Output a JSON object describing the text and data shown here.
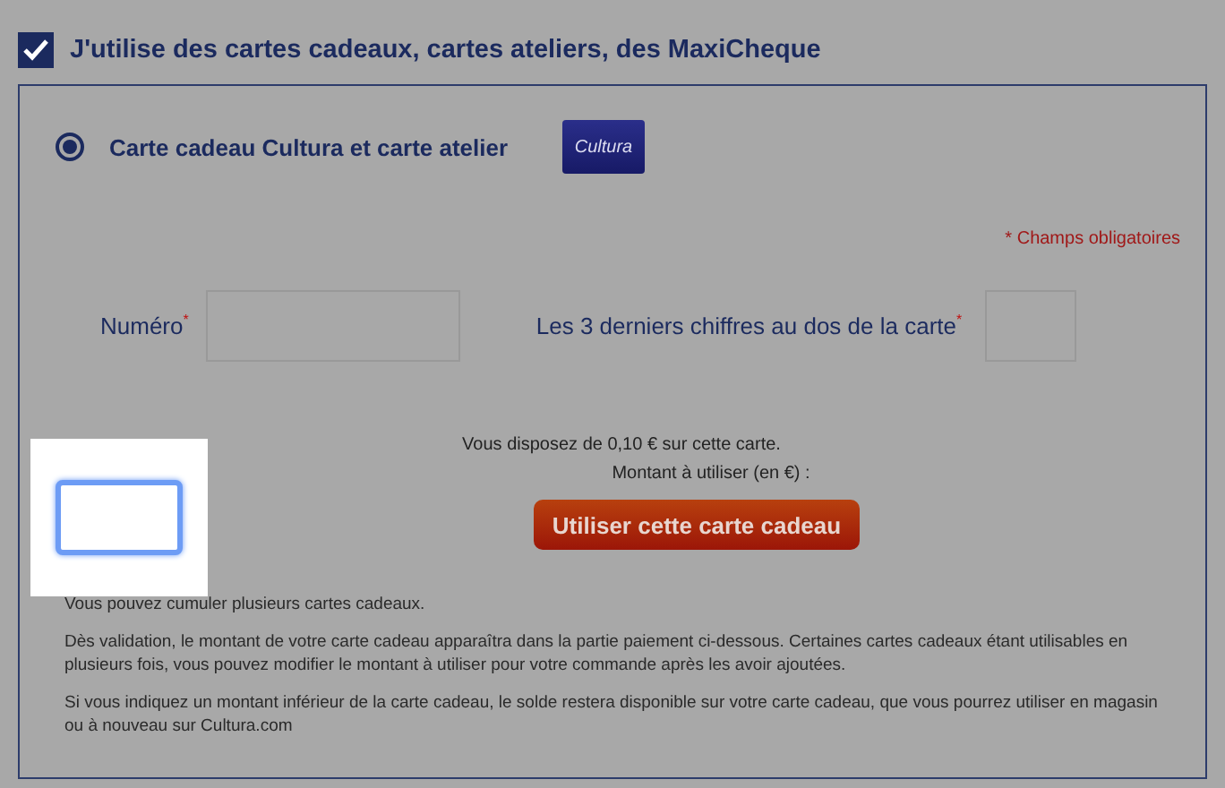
{
  "section": {
    "label": "J'utilise des cartes cadeaux, cartes ateliers, des MaxiCheque",
    "checked": true
  },
  "options": [
    {
      "label": "Carte cadeau Cultura et carte atelier",
      "selected": true,
      "logo": "Cultura"
    }
  ],
  "required_note": "* Champs obligatoires",
  "fields": [
    {
      "label": "Numéro",
      "mark": "*",
      "kind": "wide"
    },
    {
      "label": "Les 3 derniers chiffres au dos de la carte",
      "mark": "*",
      "kind": "narrow"
    }
  ],
  "balance": "Vous disposez de 0,10 € sur cette carte.",
  "amount_label": "Montant à utiliser (en €) :",
  "amount_field": {
    "focused": true
  },
  "button": "Utiliser cette carte cadeau",
  "notes": [
    "Vous pouvez cumuler plusieurs cartes cadeaux.",
    "Dès validation, le montant de votre carte cadeau apparaîtra dans la partie paiement ci-dessous. Certaines cartes cadeaux étant utilisables en plusieurs fois, vous pouvez modifier le montant à utiliser pour votre commande après les avoir ajoutées.",
    "Si vous indiquez un montant inférieur de la carte cadeau, le solde restera disponible sur votre carte cadeau, que vous pourrez utiliser en magasin ou à nouveau sur Cultura.com"
  ]
}
